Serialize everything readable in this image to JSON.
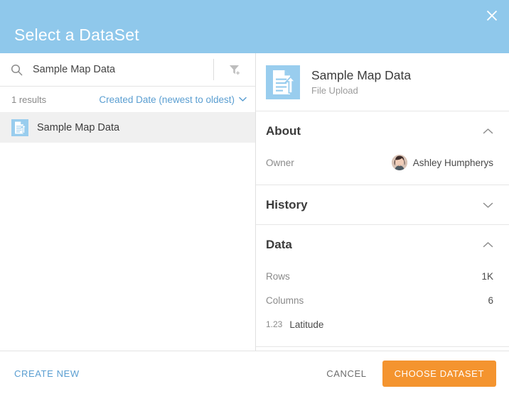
{
  "header": {
    "title": "Select a DataSet",
    "close_icon": "close-icon",
    "background_color": "#8FC8EB"
  },
  "search": {
    "icon": "search-icon",
    "value": "Sample Map Data",
    "placeholder": "Search",
    "filter_icon": "filter-add-icon"
  },
  "results": {
    "count_label": "1 results",
    "sort_label": "Created Date (newest to oldest)",
    "sort_chevron_icon": "chevron-down-icon",
    "items": [
      {
        "label": "Sample Map Data",
        "icon": "file-upload-icon",
        "selected": true
      }
    ]
  },
  "detail": {
    "icon": "file-upload-icon",
    "title": "Sample Map Data",
    "subtitle": "File Upload",
    "sections": [
      {
        "title": "About",
        "expanded": true,
        "chevron_icon": "chevron-up-icon",
        "rows": [
          {
            "key": "Owner",
            "value": "Ashley Humpherys",
            "has_avatar": true
          }
        ]
      },
      {
        "title": "History",
        "expanded": false,
        "chevron_icon": "chevron-down-icon",
        "rows": []
      },
      {
        "title": "Data",
        "expanded": true,
        "chevron_icon": "chevron-up-icon",
        "rows": [
          {
            "key": "Rows",
            "value": "1K",
            "has_avatar": false
          },
          {
            "key": "Columns",
            "value": "6",
            "has_avatar": false
          }
        ],
        "columns": [
          {
            "type": "1.23",
            "name": "Latitude"
          }
        ]
      }
    ]
  },
  "footer": {
    "create_new_label": "CREATE NEW",
    "cancel_label": "CANCEL",
    "choose_label": "CHOOSE DATASET",
    "primary_color": "#F4942F",
    "link_color": "#5A9ED1"
  }
}
